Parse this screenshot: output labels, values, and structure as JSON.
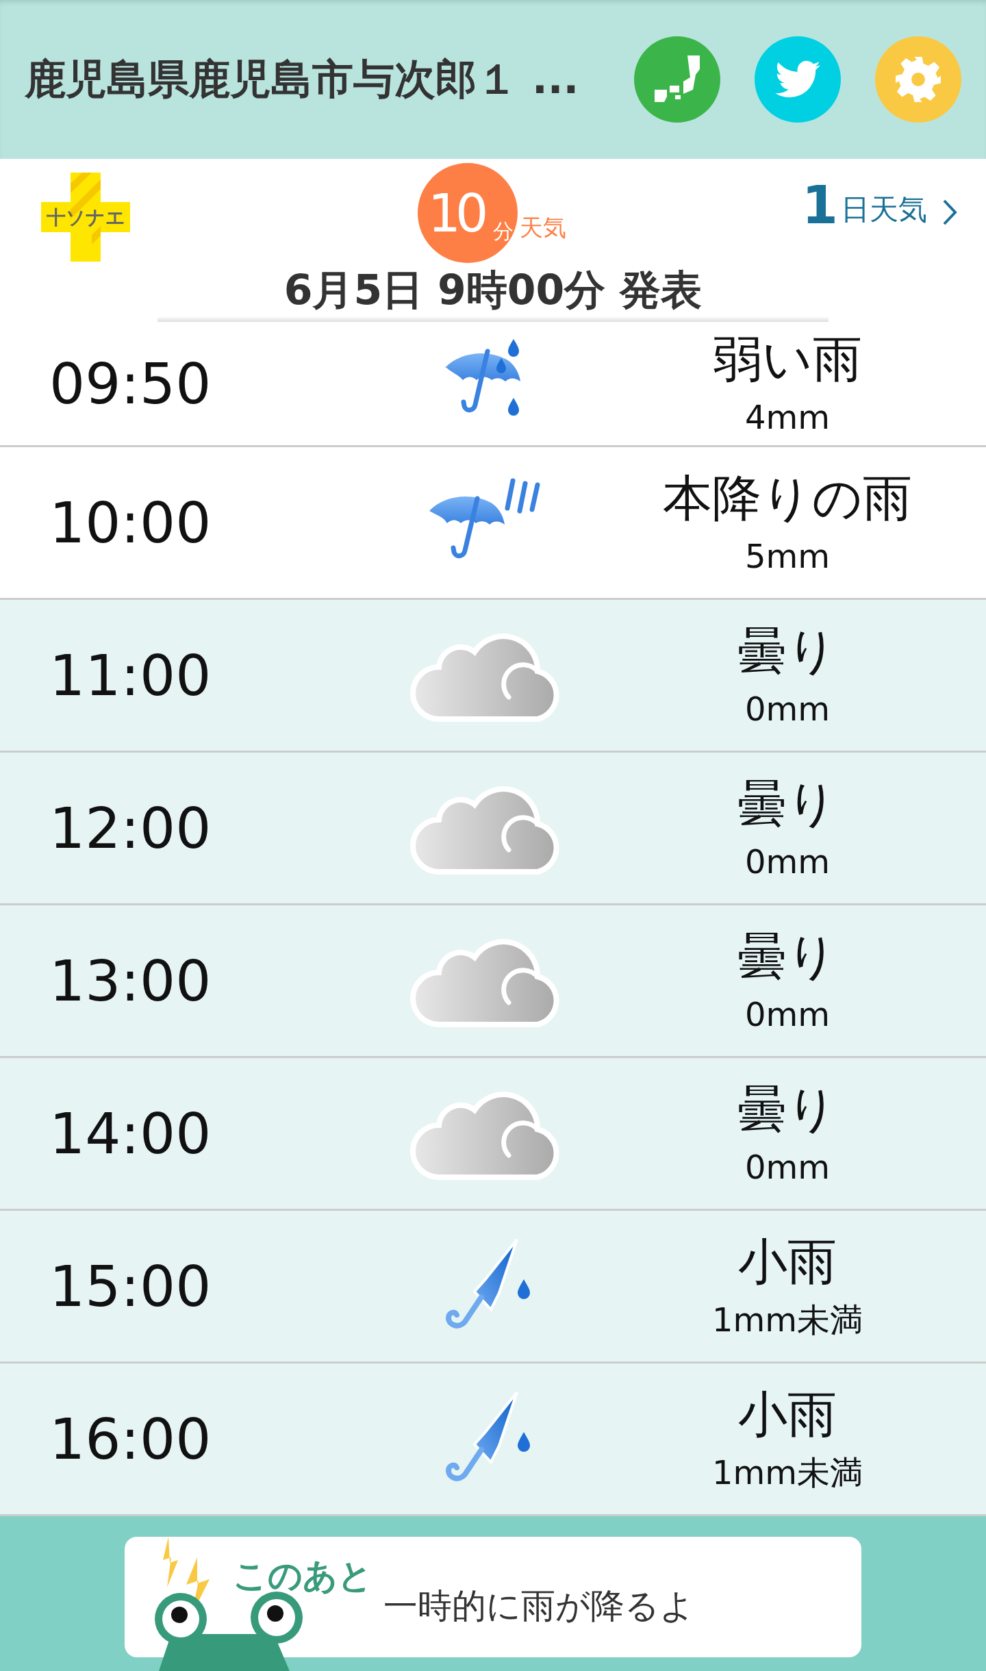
{
  "header": {
    "title": "鹿児島県鹿児島市与次郎１ ...",
    "buttons": [
      {
        "kind": "map"
      },
      {
        "kind": "twitter"
      },
      {
        "kind": "settings"
      }
    ]
  },
  "subheader": {
    "logo": "十ソナエ",
    "badge": {
      "number": "10",
      "unit": "分",
      "label": "天気"
    },
    "link": {
      "number": "1",
      "label": "日天気"
    },
    "published": "6月5日 9時00分 発表"
  },
  "forecast": [
    {
      "time": "09:50",
      "kind": "light-rain",
      "weather": "弱い雨",
      "amount": "4mm",
      "shaded": false
    },
    {
      "time": "10:00",
      "kind": "heavy-rain",
      "weather": "本降りの雨",
      "amount": "5mm",
      "shaded": false
    },
    {
      "time": "11:00",
      "kind": "cloudy",
      "weather": "曇り",
      "amount": "0mm",
      "shaded": true
    },
    {
      "time": "12:00",
      "kind": "cloudy",
      "weather": "曇り",
      "amount": "0mm",
      "shaded": true
    },
    {
      "time": "13:00",
      "kind": "cloudy",
      "weather": "曇り",
      "amount": "0mm",
      "shaded": true
    },
    {
      "time": "14:00",
      "kind": "cloudy",
      "weather": "曇り",
      "amount": "0mm",
      "shaded": true
    },
    {
      "time": "15:00",
      "kind": "drizzle",
      "weather": "小雨",
      "amount": "1mm未満",
      "shaded": true
    },
    {
      "time": "16:00",
      "kind": "drizzle",
      "weather": "小雨",
      "amount": "1mm未満",
      "shaded": true
    }
  ],
  "banner": {
    "heading": "このあと",
    "message": "一時的に雨が降るよ"
  }
}
